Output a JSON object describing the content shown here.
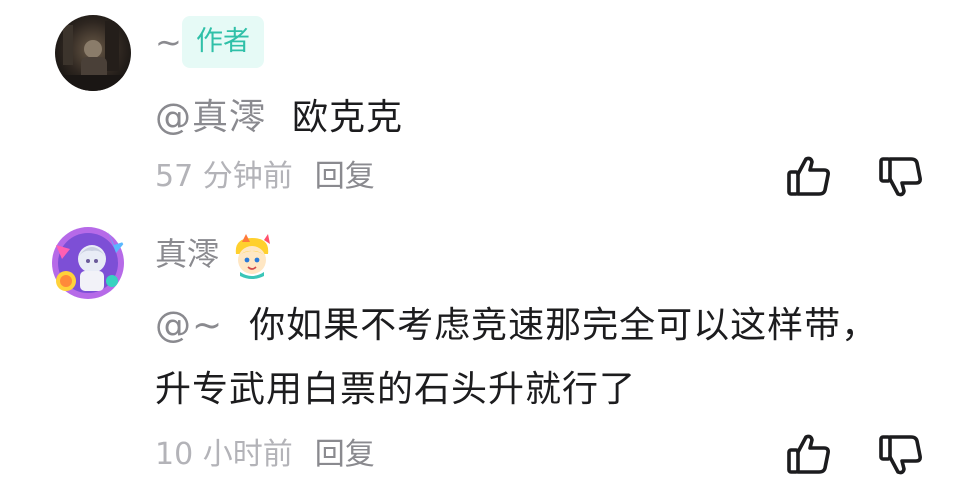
{
  "comments": [
    {
      "username": "~",
      "badge": "作者",
      "mention": "@真澪",
      "content": "欧克克",
      "time": "57 分钟前",
      "reply": "回复"
    },
    {
      "username": "真澪",
      "mention": "@~",
      "content": "你如果不考虑竞速那完全可以这样带，升专武用白票的石头升就行了",
      "time": "10 小时前",
      "reply": "回复"
    }
  ],
  "icons": {
    "like": "thumbs-up-icon",
    "dislike": "thumbs-down-icon"
  },
  "colors": {
    "accent": "#2fc0a8",
    "badge_bg": "#e6faf6",
    "secondary_text": "#8a8a8f",
    "meta_text": "#b3b3b8"
  }
}
